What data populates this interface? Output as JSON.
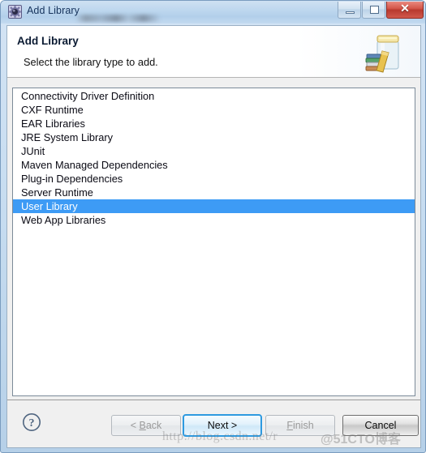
{
  "window": {
    "title": "Add Library",
    "title_icon": "eclipse-gear-icon",
    "controls": {
      "minimize": "minimize-icon",
      "maximize": "restore-icon",
      "close_glyph": "✕"
    }
  },
  "header": {
    "title": "Add Library",
    "subtitle": "Select the library type to add.",
    "icon": "library-jar-books-icon"
  },
  "list": {
    "items": [
      {
        "label": "Connectivity Driver Definition",
        "selected": false
      },
      {
        "label": "CXF Runtime",
        "selected": false
      },
      {
        "label": "EAR Libraries",
        "selected": false
      },
      {
        "label": "JRE System Library",
        "selected": false
      },
      {
        "label": "JUnit",
        "selected": false
      },
      {
        "label": "Maven Managed Dependencies",
        "selected": false
      },
      {
        "label": "Plug-in Dependencies",
        "selected": false
      },
      {
        "label": "Server Runtime",
        "selected": false
      },
      {
        "label": "User Library",
        "selected": true
      },
      {
        "label": "Web App Libraries",
        "selected": false
      }
    ]
  },
  "buttons": {
    "help": "help-icon",
    "back": "< Back",
    "back_prefix": "< ",
    "back_mnemonic": "B",
    "back_rest": "ack",
    "next": "Next >",
    "finish": "Finish",
    "finish_mnemonic": "F",
    "finish_rest": "inish",
    "cancel": "Cancel"
  },
  "watermarks": {
    "url": "http://blog.csdn.net/r",
    "site": "@51CTO博客"
  },
  "colors": {
    "selection_blue": "#3d9bf5",
    "titlebar_blue": "#bcd6ee",
    "close_red": "#c4453a",
    "default_button_focus": "#2e9ae0"
  }
}
